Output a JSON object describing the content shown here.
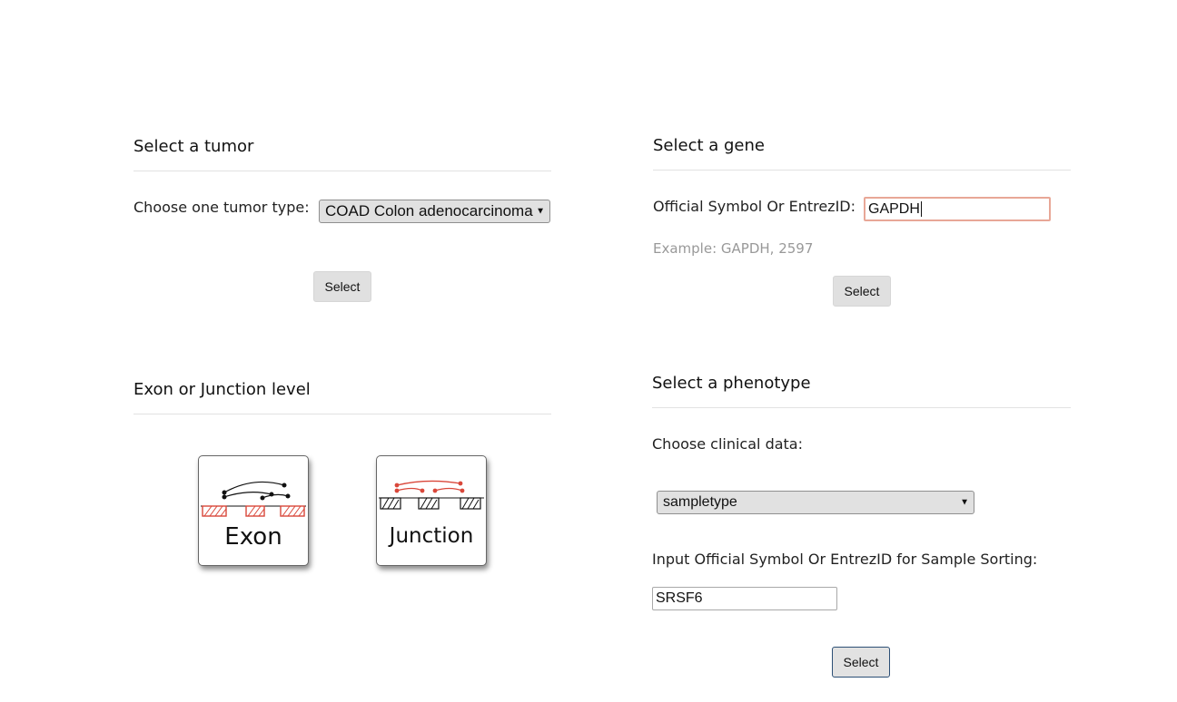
{
  "tumor": {
    "heading": "Select a tumor",
    "choose_label": "Choose one tumor type:",
    "selected_value": "COAD Colon adenocarcinoma",
    "button": "Select"
  },
  "gene": {
    "heading": "Select a gene",
    "symbol_label": "Official Symbol Or EntrezID:",
    "input_value": "GAPDH",
    "example": "Example: GAPDH, 2597",
    "button": "Select"
  },
  "level": {
    "heading": "Exon or Junction level",
    "options": [
      {
        "label": "Exon",
        "icon": "exon-icon"
      },
      {
        "label": "Junction",
        "icon": "junction-icon"
      }
    ]
  },
  "phenotype": {
    "heading": "Select a phenotype",
    "clinical_label": "Choose clinical data:",
    "clinical_value": "sampletype",
    "sorting_label": "Input Official Symbol Or EntrezID for Sample Sorting:",
    "sorting_value": "SRSF6",
    "button": "Select"
  },
  "colors": {
    "sketch_red": "#d9473a",
    "sketch_black": "#111111",
    "button_bg": "#e0e0e0",
    "focus_border": "#e8a797"
  }
}
